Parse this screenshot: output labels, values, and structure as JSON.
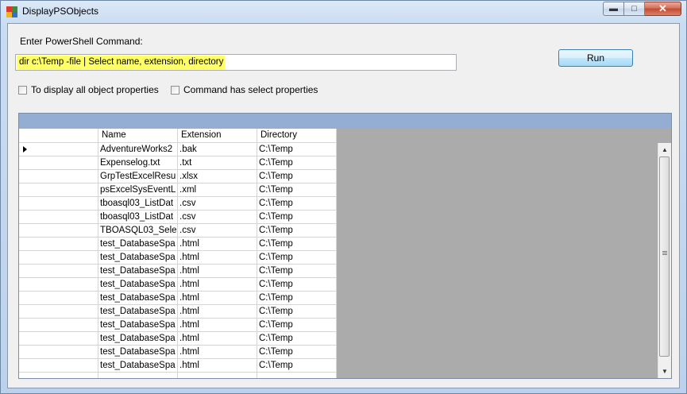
{
  "window": {
    "title": "DisplayPSObjects"
  },
  "form": {
    "command_label": "Enter PowerShell Command:",
    "command_value": "dir c:\\Temp -file | Select name, extension, directory",
    "run_label": "Run",
    "checkbox_all_props": {
      "label": "To display all object properties",
      "checked": false
    },
    "checkbox_select_props": {
      "label": "Command has select properties",
      "checked": false
    }
  },
  "grid": {
    "columns": [
      "Name",
      "Extension",
      "Directory"
    ],
    "current_row": 0,
    "rows": [
      [
        "AdventureWorks2",
        ".bak",
        "C:\\Temp"
      ],
      [
        "Expenselog.txt",
        ".txt",
        "C:\\Temp"
      ],
      [
        "GrpTestExcelResu",
        ".xlsx",
        "C:\\Temp"
      ],
      [
        "psExcelSysEventL",
        ".xml",
        "C:\\Temp"
      ],
      [
        "tboasql03_ListDat",
        ".csv",
        "C:\\Temp"
      ],
      [
        "tboasql03_ListDat",
        ".csv",
        "C:\\Temp"
      ],
      [
        "TBOASQL03_Sele",
        ".csv",
        "C:\\Temp"
      ],
      [
        "test_DatabaseSpa",
        ".html",
        "C:\\Temp"
      ],
      [
        "test_DatabaseSpa",
        ".html",
        "C:\\Temp"
      ],
      [
        "test_DatabaseSpa",
        ".html",
        "C:\\Temp"
      ],
      [
        "test_DatabaseSpa",
        ".html",
        "C:\\Temp"
      ],
      [
        "test_DatabaseSpa",
        ".html",
        "C:\\Temp"
      ],
      [
        "test_DatabaseSpa",
        ".html",
        "C:\\Temp"
      ],
      [
        "test_DatabaseSpa",
        ".html",
        "C:\\Temp"
      ],
      [
        "test_DatabaseSpa",
        ".html",
        "C:\\Temp"
      ],
      [
        "test_DatabaseSpa",
        ".html",
        "C:\\Temp"
      ],
      [
        "test_DatabaseSpa",
        ".html",
        "C:\\Temp"
      ],
      [
        "",
        "",
        ""
      ]
    ]
  },
  "icons": {
    "app": "app-icon",
    "minimize": "minimize-icon",
    "maximize": "maximize-icon",
    "close": "close-icon",
    "scroll_up": "scroll-up-icon",
    "scroll_down": "scroll-down-icon",
    "row_indicator": "current-row-arrow-icon"
  }
}
